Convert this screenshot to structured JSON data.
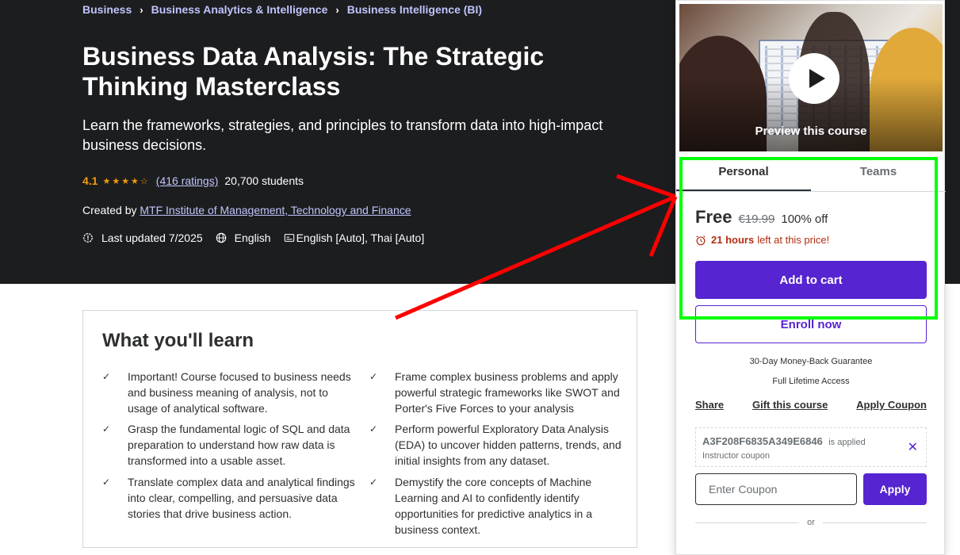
{
  "breadcrumb": [
    "Business",
    "Business Analytics & Intelligence",
    "Business Intelligence (BI)"
  ],
  "course": {
    "title": "Business Data Analysis: The Strategic Thinking Masterclass",
    "subtitle": "Learn the frameworks, strategies, and principles to transform data into high-impact business decisions.",
    "rating": "4.1",
    "rating_value": 4.1,
    "stars": "★★★★☆",
    "rating_count": "(416 ratings)",
    "students": "20,700 students",
    "created_by_label": "Created by",
    "instructor": "MTF Institute of Management, Technology and Finance",
    "last_updated": "Last updated 7/2025",
    "language": "English",
    "captions": "English [Auto], Thai [Auto]"
  },
  "learn": {
    "title": "What you'll learn",
    "items": [
      "Important! Course focused to business needs and business meaning of analysis, not to usage of analytical software.",
      "Frame complex business problems and apply powerful strategic frameworks like SWOT and Porter's Five Forces to your analysis",
      "Grasp the fundamental logic of SQL and data preparation to understand how raw data is transformed into a usable asset.",
      "Perform powerful Exploratory Data Analysis (EDA) to uncover hidden patterns, trends, and initial insights from any dataset.",
      "Translate complex data and analytical findings into clear, compelling, and persuasive data stories that drive business action.",
      "Demystify the core concepts of Machine Learning and AI to confidently identify opportunities for predictive analytics in a business context."
    ]
  },
  "sidebar": {
    "preview_label": "Preview this course",
    "tabs": [
      "Personal",
      "Teams"
    ],
    "price": "Free",
    "original_price": "€19.99",
    "discount": "100% off",
    "timer_bold": "21 hours",
    "timer_text": "left at this price!",
    "add_to_cart": "Add to cart",
    "enroll": "Enroll now",
    "guarantee": "30-Day Money-Back Guarantee",
    "lifetime": "Full Lifetime Access",
    "links": [
      "Share",
      "Gift this course",
      "Apply Coupon"
    ],
    "coupon_code": "A3F208F6835A349E6846",
    "coupon_applied": "is applied",
    "coupon_type": "Instructor coupon",
    "coupon_placeholder": "Enter Coupon",
    "apply": "Apply",
    "or": "or"
  },
  "colors": {
    "accent": "#5624d0",
    "hero_bg": "#1c1d1f",
    "link": "#c0c4fc",
    "star": "#f69c08",
    "highlight_box": "#00ff00",
    "arrow": "#ff0000"
  }
}
